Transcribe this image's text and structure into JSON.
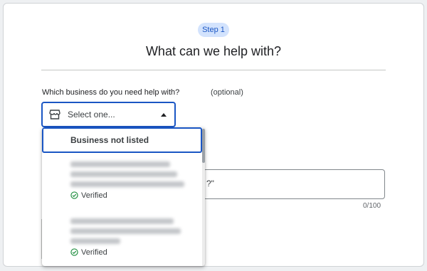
{
  "step": {
    "label": "Step 1"
  },
  "title": "What can we help with?",
  "question": {
    "label": "Which business do you need help with?",
    "optional": "(optional)"
  },
  "select": {
    "placeholder": "Select one...",
    "icon": "storefront-icon",
    "state": "expanded"
  },
  "dropdown": {
    "options": [
      {
        "label": "Business not listed",
        "selected": true
      },
      {
        "label": "",
        "verified": "Verified"
      },
      {
        "label": "",
        "verified": "Verified"
      }
    ]
  },
  "textarea": {
    "visible_text": "?\"",
    "char_count": "0/100"
  },
  "colors": {
    "accent": "#1a56c4",
    "badge_bg": "#d3e3fd",
    "verified_green": "#1e8e3e"
  }
}
